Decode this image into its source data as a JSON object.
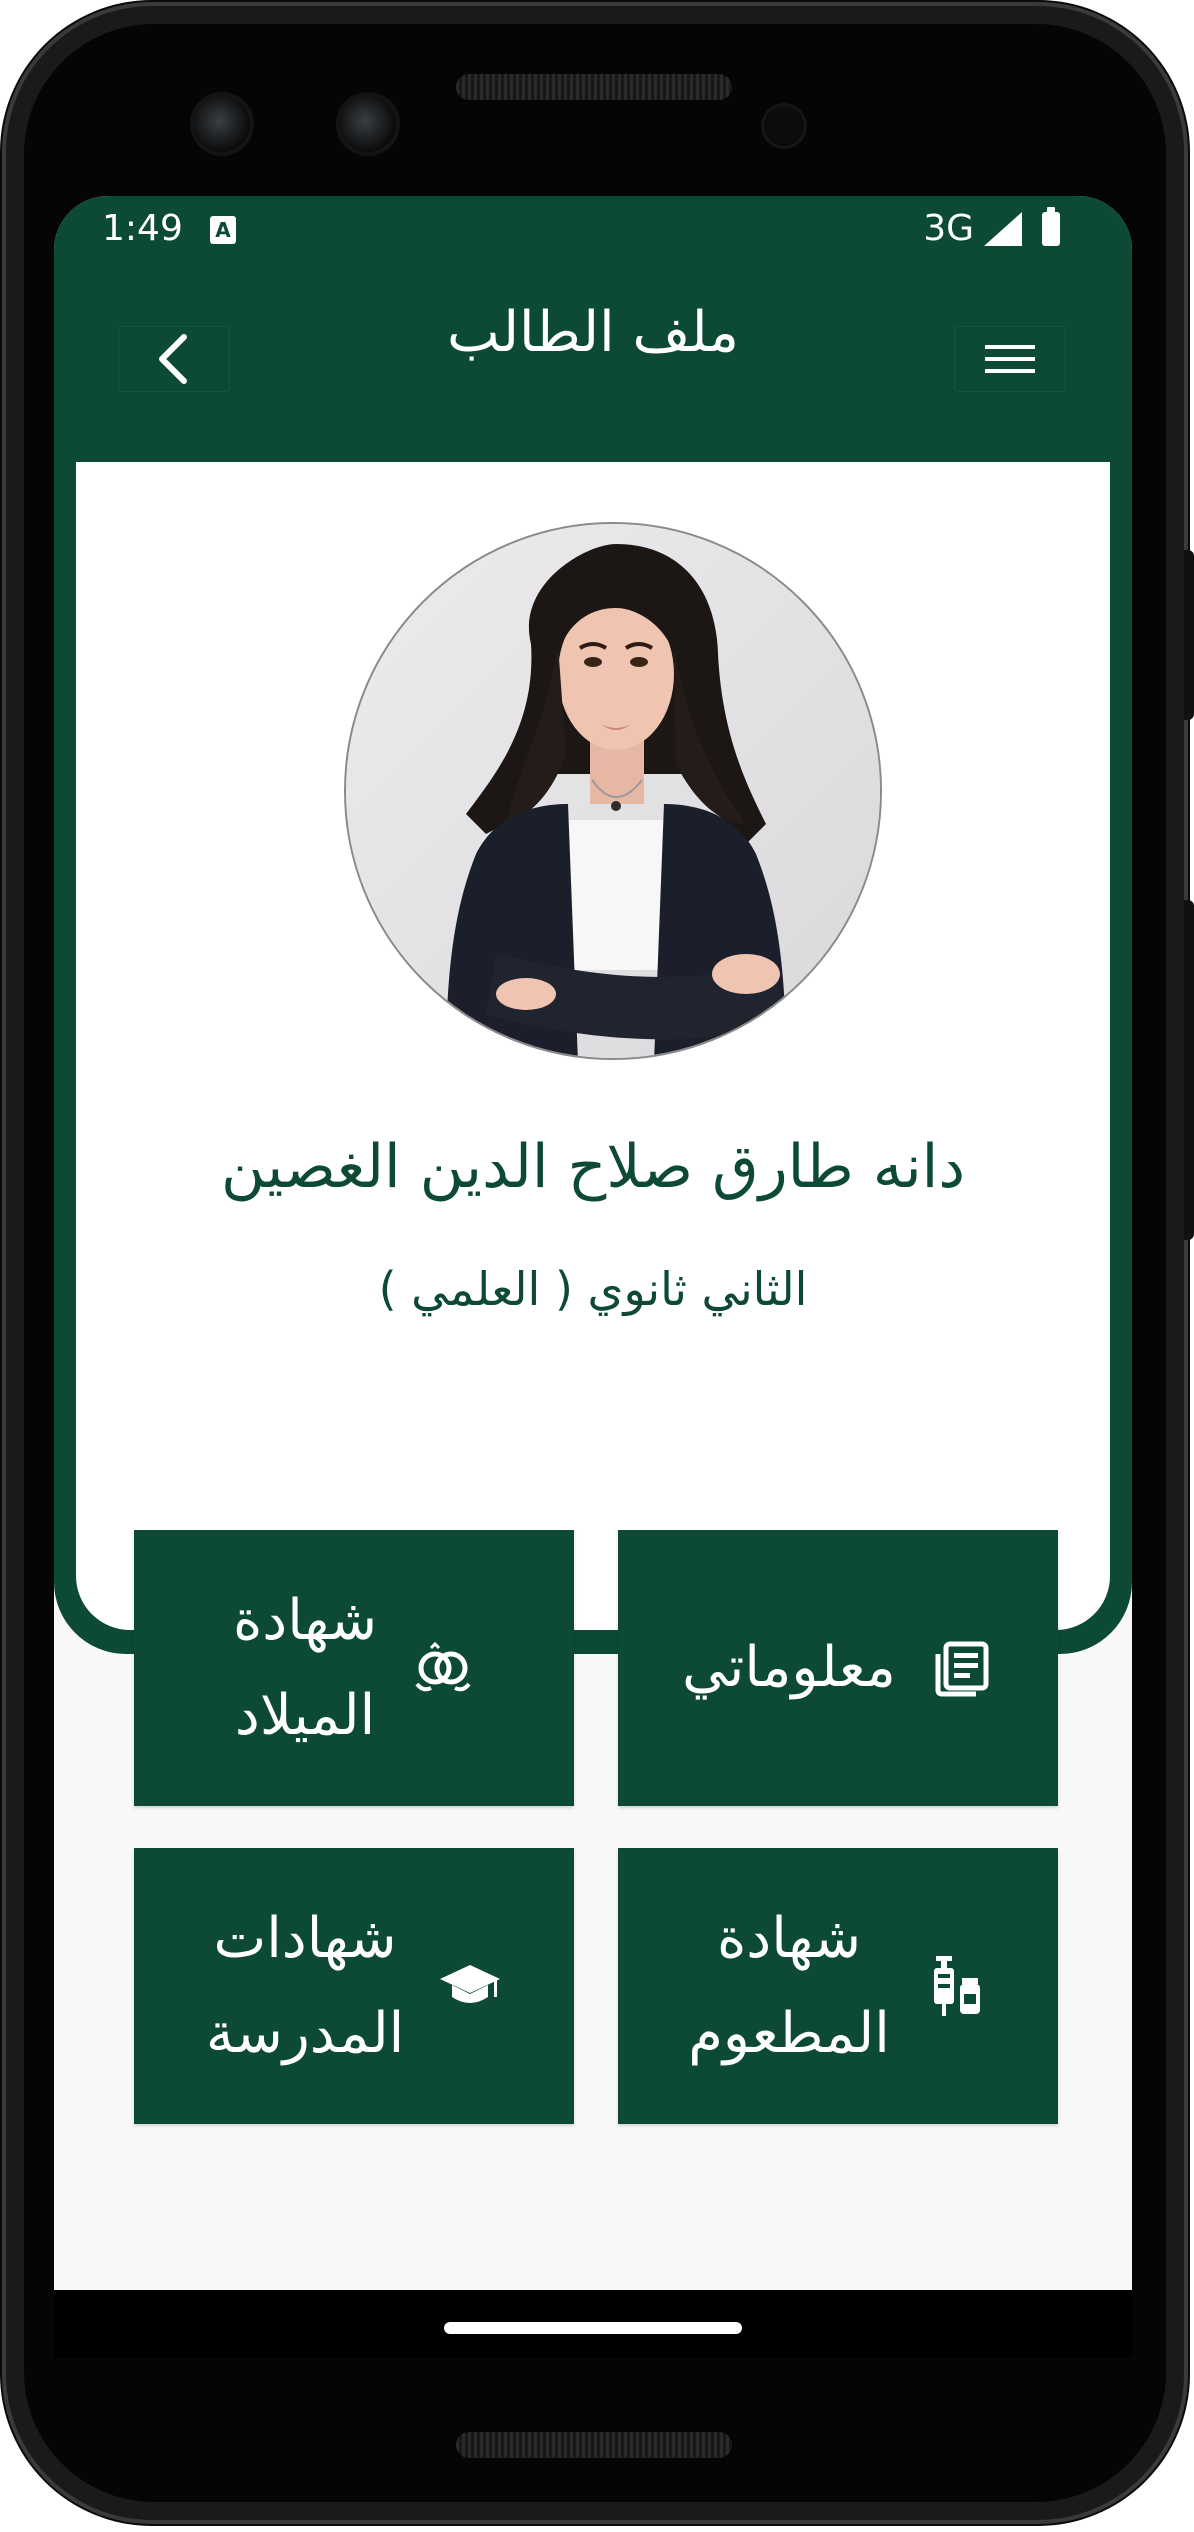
{
  "status_bar": {
    "time": "1:49",
    "notification_badge": "A",
    "network": "3G",
    "icons": [
      "signal-icon",
      "battery-icon"
    ]
  },
  "app_bar": {
    "title": "ملف الطالب",
    "back_icon": "chevron-left-icon",
    "menu_icon": "hamburger-menu-icon"
  },
  "profile": {
    "name": "دانه طارق صلاح الدين الغصين",
    "grade": "الثاني ثانوي ( العلمي )",
    "photo": "student-photo"
  },
  "tiles": [
    {
      "label": "معلوماتي",
      "icon": "news-icon"
    },
    {
      "label": "شهادة\nالميلاد",
      "icon": "rings-icon"
    },
    {
      "label": "شهادة\nالمطعوم",
      "icon": "vaccine-icon"
    },
    {
      "label": "شهادات\nالمدرسة",
      "icon": "graduation-cap-icon"
    }
  ],
  "colors": {
    "primary": "#0c4a34",
    "background": "#f8f8f8",
    "card": "#ffffff",
    "text_on_primary": "#ffffff"
  }
}
